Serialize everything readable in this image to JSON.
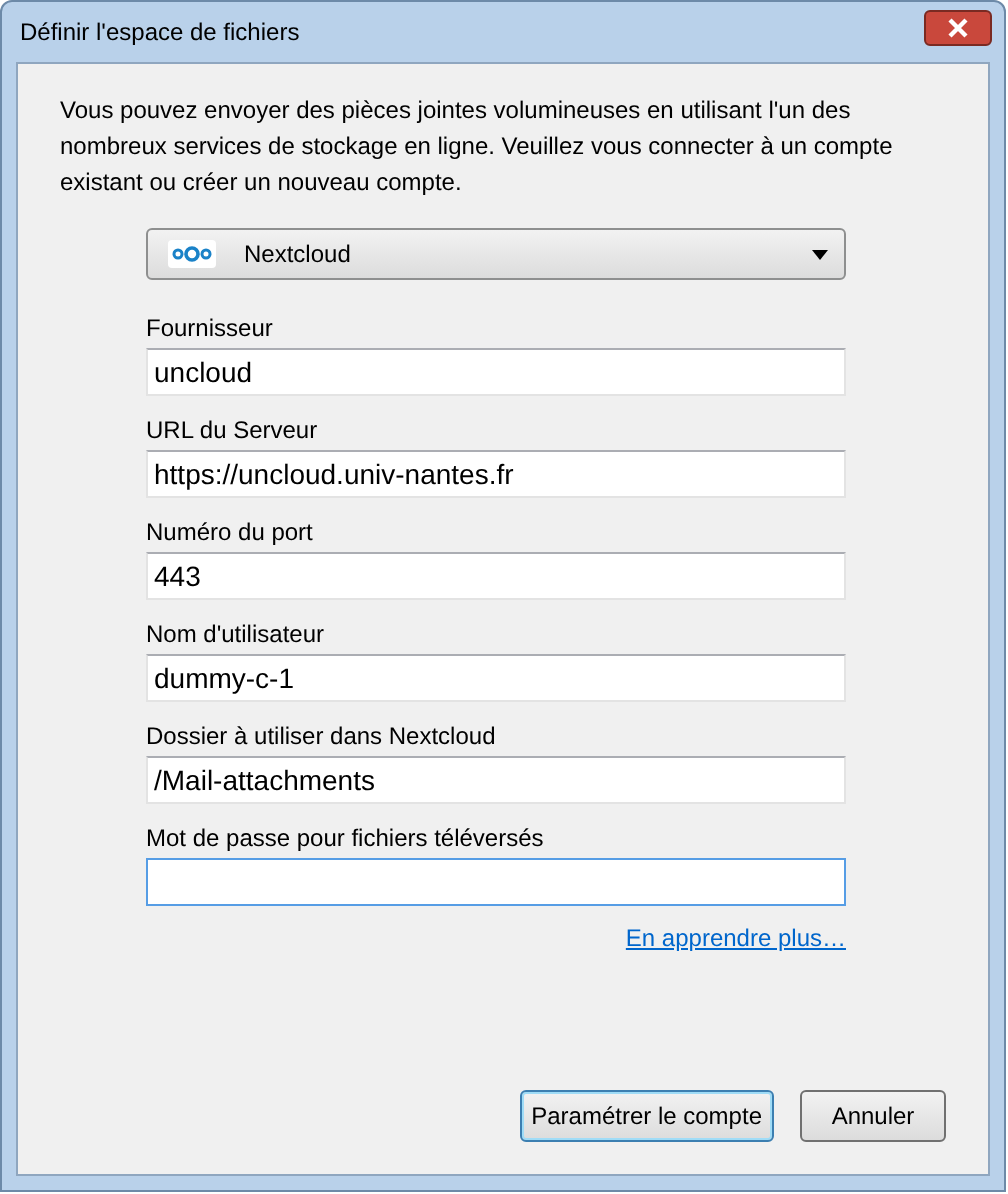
{
  "window": {
    "title": "Définir l'espace de fichiers"
  },
  "intro": "Vous pouvez envoyer des pièces jointes volumineuses en utilisant l'un des nombreux services de stockage en ligne. Veuillez vous connecter à un compte existant ou créer un nouveau compte.",
  "provider_select": {
    "value": "Nextcloud"
  },
  "fields": [
    {
      "label": "Fournisseur",
      "value": "uncloud",
      "focused": false
    },
    {
      "label": "URL du Serveur",
      "value": "https://uncloud.univ-nantes.fr",
      "focused": false
    },
    {
      "label": "Numéro du port",
      "value": "443",
      "focused": false
    },
    {
      "label": "Nom d'utilisateur",
      "value": "dummy-c-1",
      "focused": false
    },
    {
      "label": "Dossier à utiliser dans Nextcloud",
      "value": "/Mail-attachments",
      "focused": false
    },
    {
      "label": "Mot de passe pour fichiers téléversés",
      "focused": true
    }
  ],
  "learn_more_link": "En apprendre plus…",
  "buttons": [
    {
      "label": "Paramétrer le compte",
      "default": true
    },
    {
      "label": "Annuler",
      "default": false
    }
  ]
}
